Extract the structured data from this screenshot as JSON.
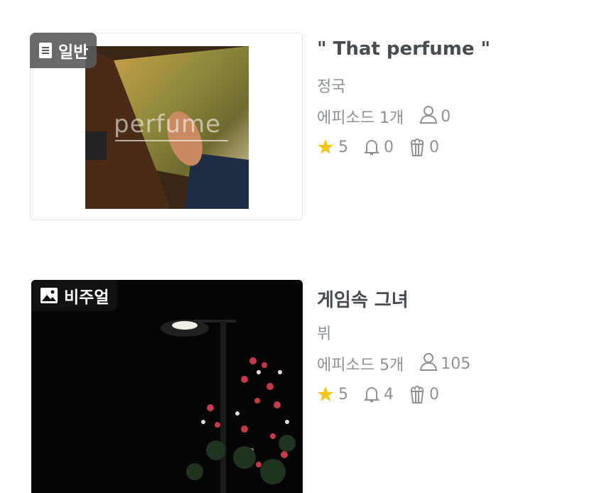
{
  "stories": [
    {
      "badge": "일반",
      "badge_icon": "document-icon",
      "cover_text": "perfume",
      "title": "\" That perfume \"",
      "author": "정국",
      "episodes": "에피소드 1개",
      "readers": "0",
      "stars": "5",
      "subscribers": "0",
      "popcorn": "0"
    },
    {
      "badge": "비주얼",
      "badge_icon": "image-icon",
      "title": "게임속 그녀",
      "author": "뷔",
      "episodes": "에피소드 5개",
      "readers": "105",
      "stars": "5",
      "subscribers": "4",
      "popcorn": "0"
    }
  ],
  "colors": {
    "star": "#f5c518",
    "badge_bg": "#5a5a5a",
    "text_muted": "#8d9296",
    "title": "#474c52"
  }
}
